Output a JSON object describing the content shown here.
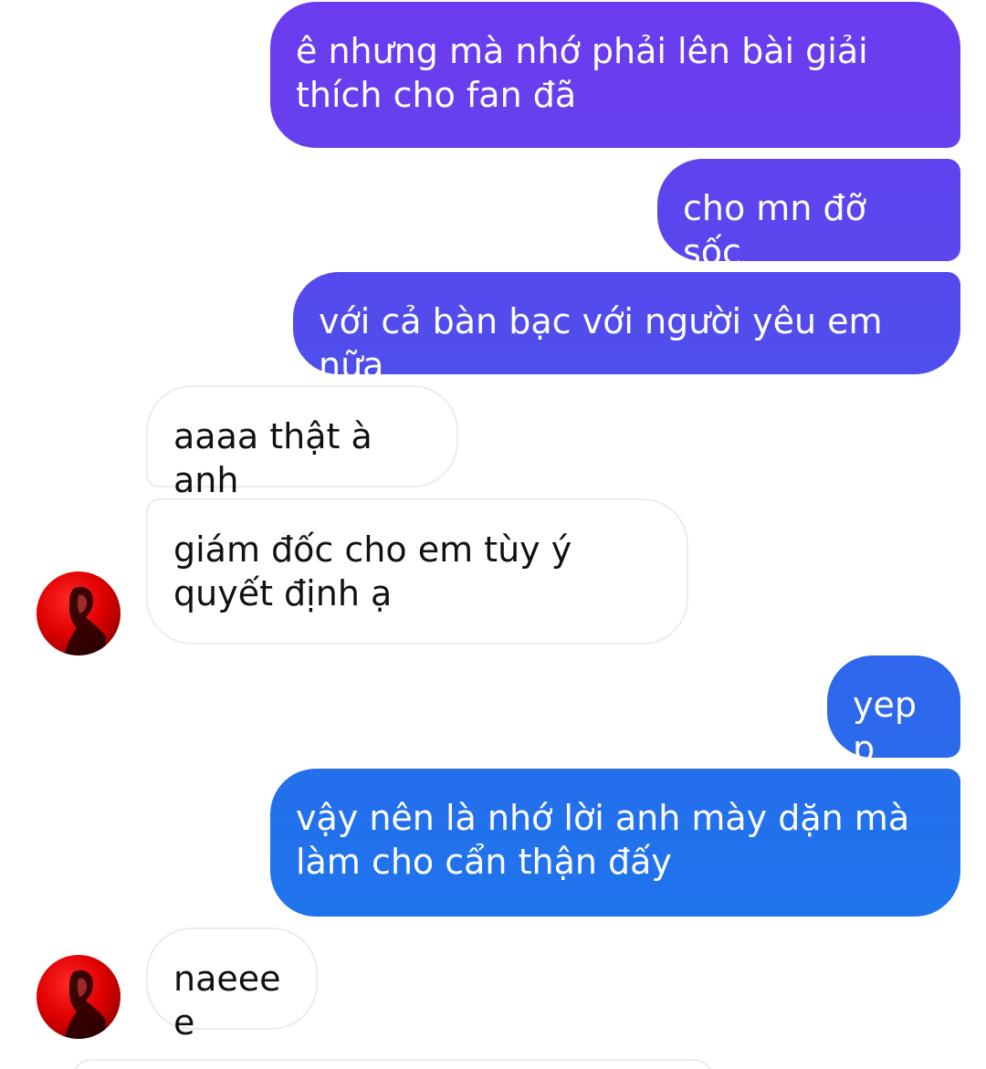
{
  "conversation": {
    "messages": [
      {
        "from": "me",
        "text": "ê nhưng mà nhớ phải lên bài giải thích cho fan đã"
      },
      {
        "from": "me",
        "text": "cho mn đỡ sốc"
      },
      {
        "from": "me",
        "text": "với cả bàn bạc với người yêu em nữa"
      },
      {
        "from": "them",
        "text": "aaaa thật à anh"
      },
      {
        "from": "them",
        "text": "giám đốc cho em tùy ý quyết định ạ"
      },
      {
        "from": "me",
        "text": "yepp"
      },
      {
        "from": "me",
        "text": "vậy nên là nhớ lời anh mày dặn mà làm cho cẩn thận đấy"
      },
      {
        "from": "them",
        "text": "naeeee"
      }
    ]
  },
  "colors": {
    "outgoing_top": "#6a3df0",
    "outgoing_bottom": "#1f74ec",
    "incoming_bg": "#ffffff",
    "incoming_border": "#ececec",
    "avatar_red": "#e00000"
  },
  "avatar": {
    "icon": "profile-photo-icon"
  }
}
